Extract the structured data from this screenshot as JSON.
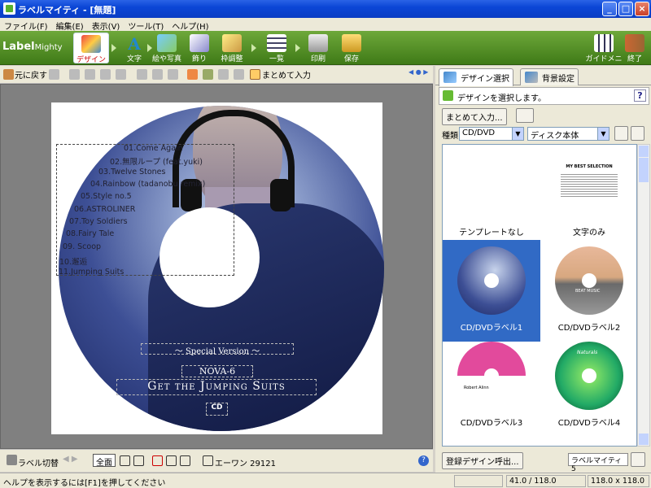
{
  "window": {
    "title": "ラベルマイティ - [無題]"
  },
  "menu": [
    "ファイル(F)",
    "編集(E)",
    "表示(V)",
    "ツール(T)",
    "ヘルプ(H)"
  ],
  "brand": {
    "main": "Label",
    "sub": "Mighty"
  },
  "toolbar": {
    "design": "デザイン",
    "text": "文字",
    "image": "絵や写真",
    "decor": "飾り",
    "frame": "枠調整",
    "list": "一覧",
    "print": "印刷",
    "save": "保存",
    "guide": "ガイドメニュー",
    "exit": "終了"
  },
  "edit_toolbar": {
    "undo": "元に戻す",
    "bulk_input": "まとめて入力"
  },
  "disc": {
    "tracks": [
      "01.Come Again",
      "02.無限ループ (feat.yuki)",
      "03.Twelve Stones",
      "04.Rainbow (tadanobu remix)",
      "05.Style no.5",
      "06.ASTROLINER",
      "07.Toy Soldiers",
      "08.Fairy Tale",
      "09. Scoop",
      "10.邂逅",
      "11.Jumping Suits"
    ],
    "edition": "～ Special Version ～",
    "artist": "NOVA-6",
    "album": "Get the Jumping Suits",
    "format": "CD"
  },
  "right_panel": {
    "tabs": [
      "デザイン選択",
      "背景設定"
    ],
    "hint": "デザインを選択します。",
    "bulk_button": "まとめて入力...",
    "kind_label": "種類",
    "kind_value": "CD/DVD",
    "style_value": "ディスク本体",
    "thumbnails": [
      {
        "label": "テンプレートなし"
      },
      {
        "label": "文字のみ",
        "title": "MY BEST SELECTION"
      },
      {
        "label": "CD/DVDラベル1"
      },
      {
        "label": "CD/DVDラベル2",
        "text": "BEAT MUSIC"
      },
      {
        "label": "CD/DVDラベル3",
        "text": "Robert Alinn"
      },
      {
        "label": "CD/DVDラベル4",
        "text": "Naturals"
      }
    ],
    "register_button": "登録デザイン呼出...",
    "product": "ラベルマイティ 5"
  },
  "bottom_toolbar": {
    "label_switch": "ラベル切替",
    "fullview": "全面",
    "product_code": "エーワン 29121"
  },
  "status": {
    "help": "ヘルプを表示するには[F1]を押してください",
    "position": "41.0 / 118.0",
    "size": "118.0 x 118.0"
  }
}
